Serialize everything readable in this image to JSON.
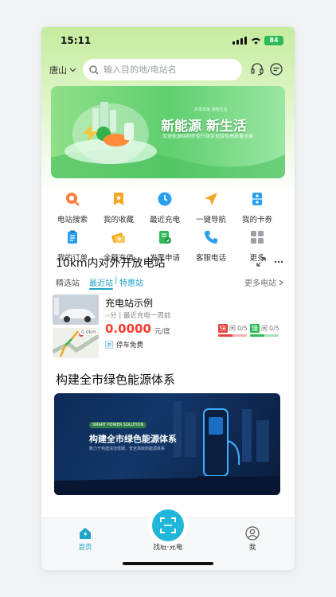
{
  "status": {
    "time": "15:11",
    "battery": "84"
  },
  "header": {
    "city": "唐山",
    "search_placeholder": "输入目的地/电站名"
  },
  "banner": {
    "title": "新能源 新生活",
    "top_text": "共享未来 绿色生活",
    "subtitle": "加速能源结构转型升级实现绿色高质量发展"
  },
  "grid": [
    {
      "label": "电站搜索",
      "icon": "magnifier-icon",
      "color": "#ff7a3d"
    },
    {
      "label": "我的收藏",
      "icon": "bookmark-icon",
      "color": "#f6a623"
    },
    {
      "label": "最近充电",
      "icon": "clock-icon",
      "color": "#2a9ff0"
    },
    {
      "label": "一键导航",
      "icon": "navigation-icon",
      "color": "#f6a623"
    },
    {
      "label": "我的卡劵",
      "icon": "card-icon",
      "color": "#2a9ff0"
    },
    {
      "label": "我的订单",
      "icon": "order-icon",
      "color": "#2a9ff0"
    },
    {
      "label": "余额充值",
      "icon": "wallet-icon",
      "color": "#f6a623"
    },
    {
      "label": "发票申请",
      "icon": "invoice-icon",
      "color": "#2dbb55"
    },
    {
      "label": "客服电话",
      "icon": "phone-icon",
      "color": "#2a9ff0"
    },
    {
      "label": "更多",
      "icon": "grid-icon",
      "color": "#9aa0a6"
    }
  ],
  "nearby": {
    "title": "10km内对外开放电站",
    "tabs": [
      "精选站",
      "最近站",
      "特惠站"
    ],
    "tab_sep": "|",
    "active_tab": 1,
    "more": "更多电站",
    "station": {
      "name": "充电站示例",
      "meta": "--分 | 最近充电一周前",
      "price": "0.0000",
      "unit": "元/度",
      "parking": "停车免费",
      "parking_badge": "P",
      "fast_tag": "快",
      "fast_status": "闲",
      "fast_count": "0/5",
      "slow_tag": "慢",
      "slow_status": "闲",
      "slow_count": "0/5",
      "map_distance": "0.0km"
    }
  },
  "green": {
    "title": "构建全市绿色能源体系",
    "promo_tag": "SMART POWER SOLUTION",
    "promo_title": "构建全市绿色能源体系",
    "promo_sub": "致力于构建清洁低碳、安全高效的能源体系"
  },
  "tabbar": {
    "home": "首页",
    "scan": "找桩·充电",
    "me": "我"
  },
  "colors": {
    "accent": "#1fa3c9",
    "price": "#ff3b30",
    "fast": "#e8413b",
    "slow": "#2dbb55"
  }
}
